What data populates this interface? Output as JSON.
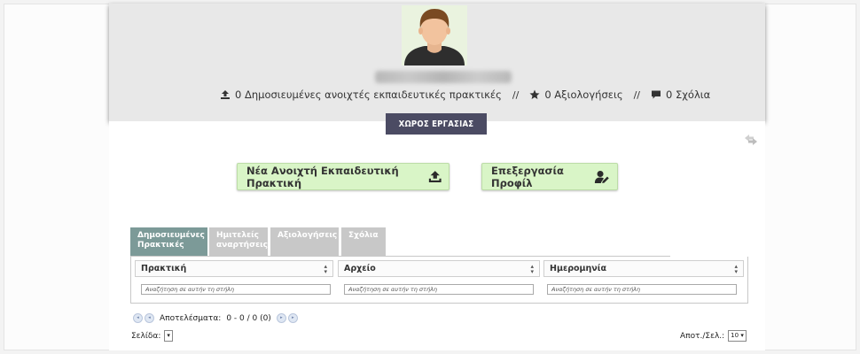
{
  "header": {
    "stats": {
      "practices_count": "0",
      "practices_label": "Δημοσιευμένες ανοιχτές εκπαιδευτικές πρακτικές",
      "separator": "//",
      "ratings_count": "0",
      "ratings_label": "Αξιολογήσεις",
      "comments_count": "0",
      "comments_label": "Σχόλια"
    },
    "workspace_label": "ΧΩΡΟΣ ΕΡΓΑΣΙΑΣ"
  },
  "actions": {
    "new_practice": "Νέα Ανοιχτή Εκπαιδευτική Πρακτική",
    "edit_profile": "Επεξεργασία Προφίλ"
  },
  "tabs": [
    {
      "label": "Δημοσιευμένες Πρακτικές",
      "active": true
    },
    {
      "label": "Ημιτελείς αναρτήσεις",
      "active": false
    },
    {
      "label": "Αξιολογήσεις",
      "active": false
    },
    {
      "label": "Σχόλια",
      "active": false
    }
  ],
  "table": {
    "columns": [
      "Πρακτική",
      "Αρχείο",
      "Ημερομηνία"
    ],
    "filter_placeholder": "Αναζήτηση σε αυτήν τη στήλη"
  },
  "pager": {
    "results_label": "Αποτελέσματα:",
    "results_value": "0 - 0 / 0 (0)",
    "page_label": "Σελίδα:",
    "page_value": "",
    "per_page_label": "Αποτ./Σελ.:",
    "per_page_value": "10"
  },
  "colors": {
    "header_bg": "#e8e8e8",
    "workspace_tab": "#4b4b63",
    "action_button": "#d9f5c7",
    "active_tab": "#7c9a98",
    "inactive_tab": "#c8c8c8"
  }
}
